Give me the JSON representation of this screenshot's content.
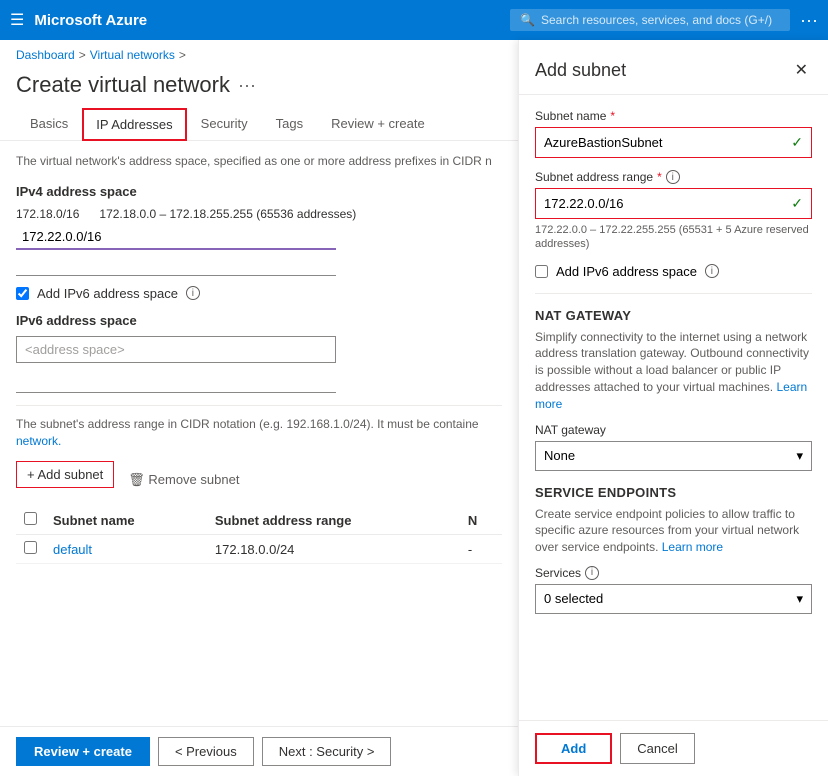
{
  "nav": {
    "menu_icon": "☰",
    "title": "Microsoft Azure",
    "search_placeholder": "Search resources, services, and docs (G+/)",
    "more_icon": "···"
  },
  "breadcrumb": {
    "dashboard": "Dashboard",
    "separator1": ">",
    "virtual_networks": "Virtual networks",
    "separator2": ">"
  },
  "page": {
    "title": "Create virtual network",
    "dots": "···"
  },
  "tabs": [
    {
      "label": "Basics",
      "state": "normal"
    },
    {
      "label": "IP Addresses",
      "state": "active-highlighted"
    },
    {
      "label": "Security",
      "state": "normal"
    },
    {
      "label": "Tags",
      "state": "normal"
    },
    {
      "label": "Review + create",
      "state": "normal"
    }
  ],
  "content": {
    "description": "The virtual network's address space, specified as one or more address prefixes in CIDR n",
    "ipv4_section_label": "IPv4 address space",
    "ipv4_address": "172.18.0/16",
    "ipv4_range": "172.18.0.0 – 172.18.255.255 (65536 addresses)",
    "ipv4_input_value": "172.22.0.0/16",
    "ipv4_empty_input": "",
    "ipv6_checkbox_label": "Add IPv6 address space",
    "ipv6_checked": true,
    "ipv6_section_label": "IPv6 address space",
    "ipv6_placeholder": "<address space>",
    "subnet_warning": "The subnet's address range in CIDR notation (e.g. 192.168.1.0/24). It must be containe network.",
    "subnet_warning_link": "network.",
    "add_subnet_label": "+ Add subnet",
    "remove_subnet_label": "🗑 Remove subnet",
    "table": {
      "col1": "Subnet name",
      "col2": "Subnet address range",
      "col3": "N",
      "rows": [
        {
          "name": "default",
          "range": "172.18.0.0/24",
          "extra": "-"
        }
      ]
    }
  },
  "bottom_bar": {
    "review_create": "Review + create",
    "previous": "< Previous",
    "next": "Next : Security >"
  },
  "panel": {
    "title": "Add subnet",
    "close_icon": "✕",
    "subnet_name_label": "Subnet name",
    "subnet_name_required": "*",
    "subnet_name_value": "AzureBastionSubnet",
    "subnet_address_label": "Subnet address range",
    "subnet_address_required": "*",
    "subnet_address_info": "ⓘ",
    "subnet_address_value": "172.22.0.0/16",
    "subnet_address_hint": "172.22.0.0 – 172.22.255.255 (65531 + 5 Azure reserved addresses)",
    "ipv6_checkbox_label": "Add IPv6 address space",
    "ipv6_info": "ⓘ",
    "nat_gateway_section": "NAT GATEWAY",
    "nat_gateway_desc": "Simplify connectivity to the internet using a network address translation gateway. Outbound connectivity is possible without a load balancer or public IP addresses attached to your virtual machines.",
    "nat_gateway_link": "Learn more",
    "nat_gateway_label": "NAT gateway",
    "nat_gateway_value": "None",
    "service_endpoints_section": "SERVICE ENDPOINTS",
    "service_endpoints_desc": "Create service endpoint policies to allow traffic to specific azure resources from your virtual network over service endpoints.",
    "service_endpoints_link": "Learn more",
    "services_label": "Services",
    "services_info": "ⓘ",
    "services_value": "0 selected",
    "add_button": "Add",
    "cancel_button": "Cancel"
  }
}
